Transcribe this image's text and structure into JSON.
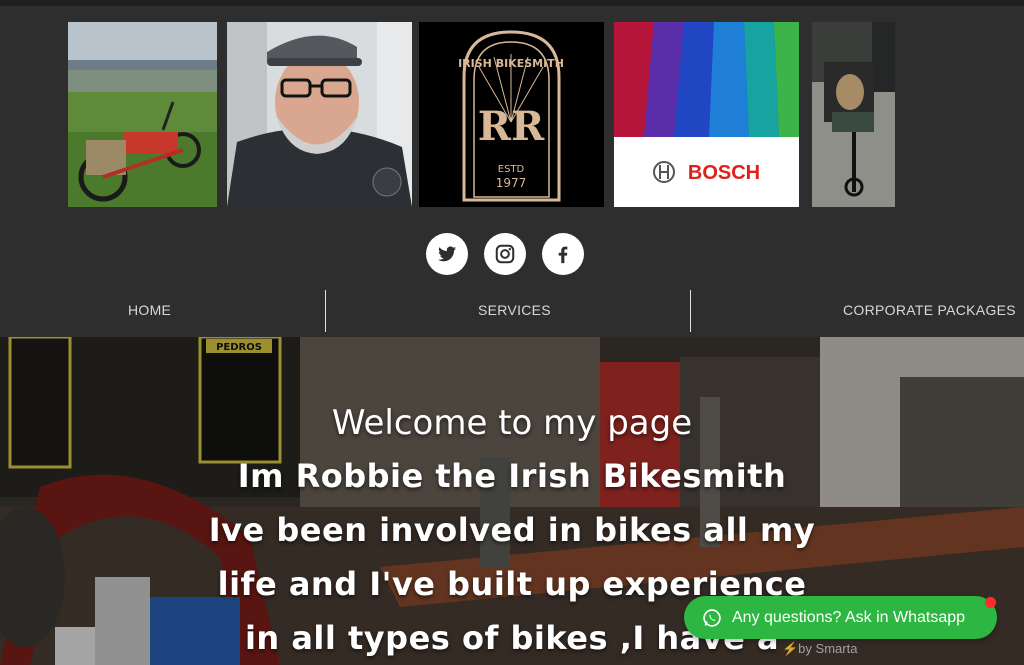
{
  "gallery": {
    "items": [
      {
        "icon": "cargo-bike-seaside-photo"
      },
      {
        "icon": "bearded-man-selfie-photo"
      },
      {
        "icon": "rr-irish-bikesmith-logo",
        "text": {
          "top": "IRISH BIKESMITH",
          "mono": "RR",
          "estd": "ESTD",
          "year": "1977"
        }
      },
      {
        "icon": "bosch-logo-photo",
        "text": {
          "brand": "BOSCH"
        }
      },
      {
        "icon": "dog-on-cargo-bike-photo"
      }
    ]
  },
  "social": [
    {
      "icon": "twitter-icon"
    },
    {
      "icon": "instagram-icon"
    },
    {
      "icon": "facebook-icon"
    }
  ],
  "nav": {
    "items": [
      {
        "label": "HOME"
      },
      {
        "label": "SERVICES"
      },
      {
        "label": "CORPORATE PACKAGES"
      }
    ]
  },
  "hero": {
    "lines": [
      "Welcome to my page",
      "Im Robbie the Irish Bikesmith",
      "Ive been involved in bikes all my",
      "life and I've built up experience",
      "in all types of bikes ,I have a"
    ],
    "sign": "PEDROS"
  },
  "whatsapp": {
    "label": "Any questions? Ask in Whatsapp",
    "powered": "⚡by Smarta",
    "color": "#2db742"
  }
}
